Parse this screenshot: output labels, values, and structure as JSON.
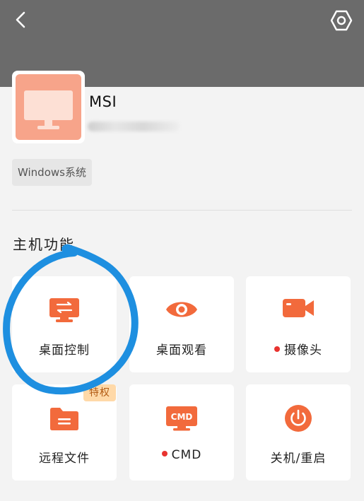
{
  "device": {
    "name": "MSI",
    "os_badge": "Windows系统"
  },
  "section": {
    "title": "主机功能"
  },
  "features": [
    {
      "label": "桌面控制",
      "icon": "desktop-control-icon",
      "dot": false
    },
    {
      "label": "桌面观看",
      "icon": "eye-icon",
      "dot": false
    },
    {
      "label": "摄像头",
      "icon": "camera-icon",
      "dot": true
    },
    {
      "label": "远程文件",
      "icon": "folder-icon",
      "dot": false
    },
    {
      "label": "CMD",
      "icon": "cmd-icon",
      "dot": true,
      "icon_text": "CMD"
    },
    {
      "label": "关机/重启",
      "icon": "power-icon",
      "dot": false
    }
  ],
  "privilege_badge": "特权",
  "colors": {
    "accent": "#f26a3c",
    "header": "#6b6b6b",
    "avatar": "#f7a48a",
    "annotation": "#1e8fe0",
    "status_dot": "#e8332f"
  }
}
